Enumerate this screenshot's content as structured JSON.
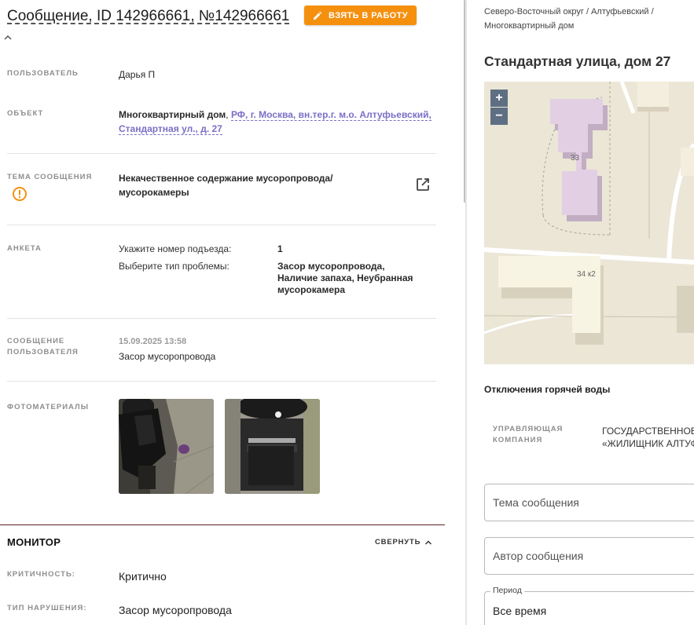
{
  "header": {
    "title": "Сообщение, ID 142966661, №142966661",
    "take_button": "ВЗЯТЬ В РАБОТУ"
  },
  "details": {
    "user_label": "ПОЛЬЗОВАТЕЛЬ",
    "user_value": "Дарья П",
    "object_label": "ОБЪЕКТ",
    "object_type": "Многоквартирный дом",
    "object_sep": ", ",
    "object_addr_line1": "РФ, г. Москва, вн.тер.г. м.о. Алтуфьевский,",
    "object_addr_line2": "Стандартная ул., д. 27",
    "topic_label": "ТЕМА СООБЩЕНИЯ",
    "topic_line1": "Некачественное содержание мусоропровода/",
    "topic_line2": "мусорокамеры",
    "anketa_label": "АНКЕТА",
    "anketa_q1": "Укажите номер подъезда:",
    "anketa_a1": "1",
    "anketa_q2": "Выберите тип проблемы:",
    "anketa_a2": "Засор мусоропровода, Наличие запаха, Неубранная мусорокамера",
    "message_label_line1": "СООБЩЕНИЕ",
    "message_label_line2": "ПОЛЬЗОВАТЕЛЯ",
    "message_date": "15.09.2025 13:58",
    "message_text": "Засор мусоропровода",
    "photos_label": "ФОТОМАТЕРИАЛЫ"
  },
  "monitor": {
    "title": "МОНИТОР",
    "collapse_label": "СВЕРНУТЬ",
    "criticality_label": "КРИТИЧНОСТЬ:",
    "criticality_value": "Критично",
    "violation_label": "ТИП НАРУШЕНИЯ:",
    "violation_value": "Засор мусоропровода"
  },
  "sidebar": {
    "breadcrumb_line1": "Северо-Восточный округ / Алтуфьевский /",
    "breadcrumb_line2": "Многоквартирный дом",
    "address": "Стандартная улица, дом 27",
    "map": {
      "zoom_in": "+",
      "zoom_out": "−",
      "building_a": "33",
      "building_b": "34 к2"
    },
    "hot_water": "Отключения горячей воды",
    "uk_label_line1": "УПРАВЛЯЮЩАЯ",
    "uk_label_line2": "КОМПАНИЯ",
    "uk_value_line1": "ГОСУДАРСТВЕННОЕ",
    "uk_value_line2": "«ЖИЛИЩНИК АЛТУФ",
    "topic_placeholder": "Тема сообщения",
    "author_placeholder": "Автор сообщения",
    "period_label": "Период",
    "period_value": "Все время"
  },
  "colors": {
    "accent": "#f5900f",
    "link": "#7a6fc7",
    "warning": "#f5900f"
  }
}
